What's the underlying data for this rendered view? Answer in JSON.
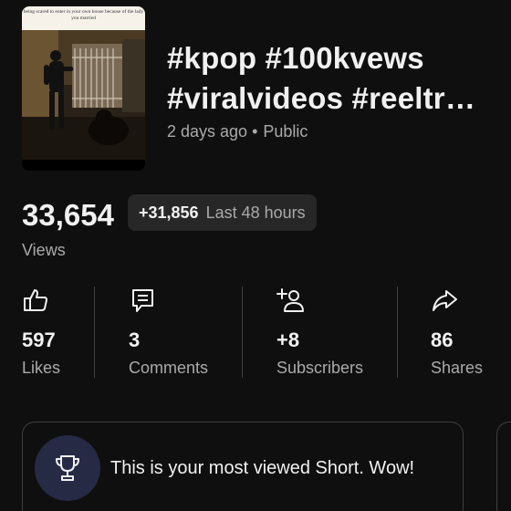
{
  "video": {
    "thumbnail_caption": "being scared to enter in your own house because of the lady you married",
    "title_line1": "#kpop #100kvews",
    "title_line2": "#viralvideos #reeltr…",
    "age": "2 days ago",
    "separator": "•",
    "visibility": "Public"
  },
  "views": {
    "count": "33,654",
    "delta": "+31,856",
    "period": "Last 48 hours",
    "label": "Views"
  },
  "stats": [
    {
      "value": "597",
      "label": "Likes",
      "icon": "thumbs-up-icon"
    },
    {
      "value": "3",
      "label": "Comments",
      "icon": "comment-icon"
    },
    {
      "value": "+8",
      "label": "Subscribers",
      "icon": "add-person-icon"
    },
    {
      "value": "86",
      "label": "Shares",
      "icon": "share-icon"
    }
  ],
  "achievement": {
    "icon": "trophy-icon",
    "text": "This is your most viewed Short. Wow!"
  },
  "colors": {
    "background": "#0f0f0f",
    "text_primary": "#f1f1f1",
    "text_secondary": "#aaaaaa",
    "pill": "#272727",
    "trophy_circle": "#272a45"
  }
}
